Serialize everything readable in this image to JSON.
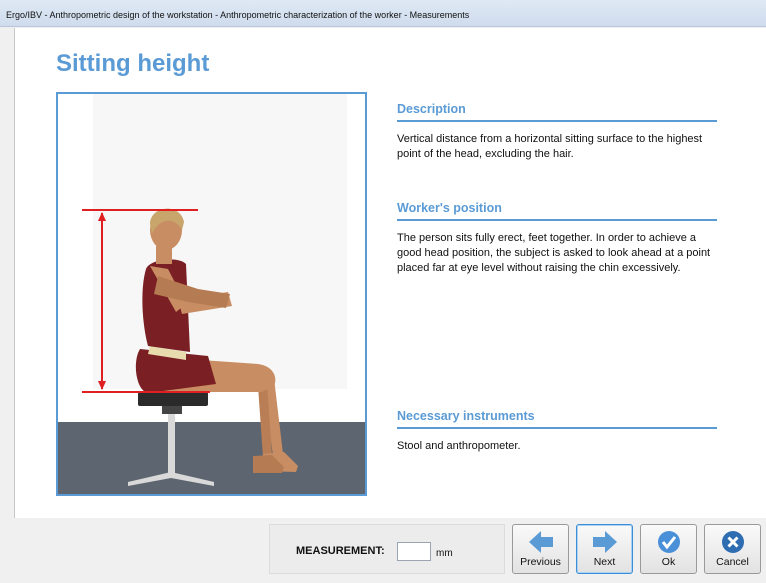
{
  "window": {
    "title": "Ergo/IBV - Anthropometric design of the workstation - Anthropometric characterization of the worker - Measurements"
  },
  "page": {
    "title": "Sitting height"
  },
  "sections": {
    "description": {
      "title": "Description",
      "text": "Vertical distance from a horizontal sitting surface to the highest point of the head, excluding the hair."
    },
    "workers_position": {
      "title": "Worker's position",
      "text": "The person sits fully erect, feet together. In order to achieve a good head position, the subject is asked to look ahead at a point placed far at eye level without raising the chin excessively."
    },
    "instruments": {
      "title": "Necessary instruments",
      "text": "Stool and anthropometer."
    }
  },
  "measurement": {
    "label": "MEASUREMENT:",
    "value": "",
    "unit": "mm"
  },
  "buttons": {
    "previous": "Previous",
    "next": "Next",
    "ok": "Ok",
    "cancel": "Cancel"
  },
  "colors": {
    "accent": "#5b9bd5",
    "measure_line": "#e02020",
    "floor": "#5d6670",
    "cancel_icon": "#2f6db3"
  }
}
